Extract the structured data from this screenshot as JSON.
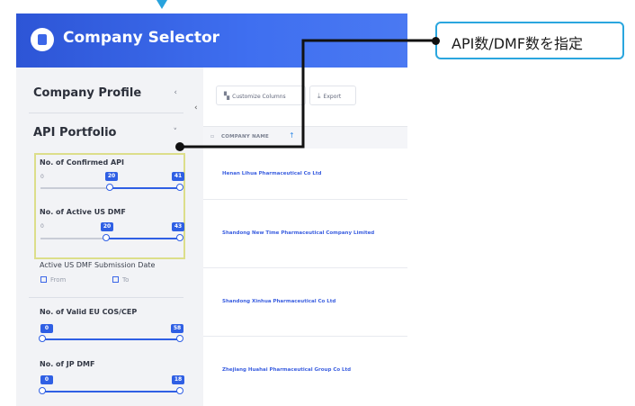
{
  "app": {
    "title": "Company Selector"
  },
  "sidebar": {
    "profile_label": "Company Profile",
    "portfolio_label": "API Portfolio",
    "sliders": [
      {
        "label": "No. of Confirmed API",
        "min_label": "0",
        "low": "20",
        "high": "41"
      },
      {
        "label": "No. of Active US DMF",
        "min_label": "0",
        "low": "20",
        "high": "43"
      },
      {
        "label": "No. of Valid EU COS/CEP",
        "low": "0",
        "high": "58"
      },
      {
        "label": "No. of JP DMF",
        "low": "0",
        "high": "18"
      }
    ],
    "date_filter": {
      "label": "Active US DMF Submission Date",
      "from_placeholder": "From",
      "to_placeholder": "To"
    }
  },
  "toolbar": {
    "customize_label": "Customize Columns",
    "export_label": "Export"
  },
  "table": {
    "column_header": "COMPANY NAME",
    "rows": [
      "Henan Lihua Pharmaceutical Co Ltd",
      "Shandong New Time Pharmaceutical Company Limited",
      "Shandong Xinhua Pharmaceutical Co Ltd",
      "Zhejiang Huahai Pharmaceutical Group Co Ltd"
    ]
  },
  "callout": {
    "text": "API数/DMF数を指定"
  },
  "colors": {
    "accent": "#2f5fe4",
    "callout_border": "#2aa6de",
    "highlight": "#dcde8a"
  },
  "icons": [
    "building-icon",
    "chevron-left-icon",
    "chevron-down-icon",
    "columns-icon",
    "export-icon",
    "lock-icon",
    "sort-up-icon",
    "calendar-icon"
  ]
}
